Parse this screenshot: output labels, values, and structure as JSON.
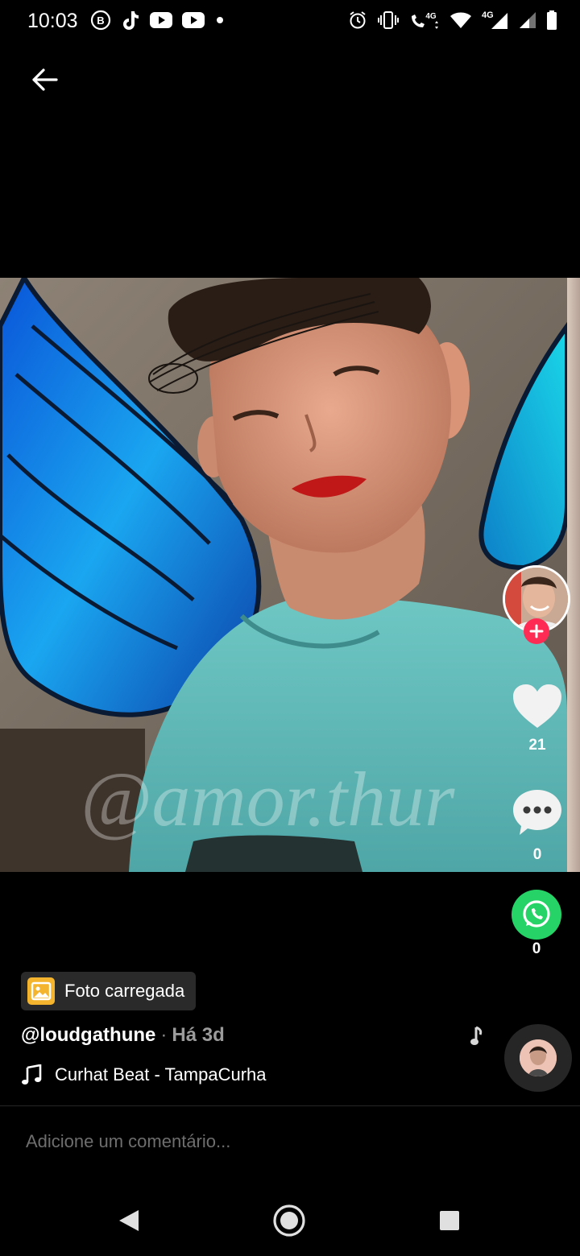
{
  "status_bar": {
    "time": "10:03",
    "left_icons": [
      "b-icon",
      "tiktok-icon",
      "youtube-icon",
      "youtube-icon",
      "dot-icon"
    ],
    "right_icons": [
      "alarm-icon",
      "vibrate-icon",
      "volte-call-icon",
      "wifi-icon",
      "signal-icon",
      "signal-icon",
      "battery-icon"
    ],
    "network_label": "4G",
    "call_label": "4G"
  },
  "nav": {
    "back_icon": "arrow-left-icon"
  },
  "photo": {
    "watermark": "@amor.thur"
  },
  "rail": {
    "like_count": "21",
    "comment_count": "0",
    "share_count": "0",
    "like_color": "#ffffff",
    "share_color": "#25d366",
    "follow_color": "#fe2c55"
  },
  "post": {
    "badge_label": "Foto carregada",
    "username": "@loudgathune",
    "separator": "·",
    "posted_time": "Há 3d",
    "music": "Curhat Beat - TampaCurha"
  },
  "comment": {
    "placeholder": "Adicione um comentário..."
  },
  "system_nav": {
    "back": "back-triangle-icon",
    "home": "home-circle-icon",
    "recents": "recents-square-icon"
  }
}
